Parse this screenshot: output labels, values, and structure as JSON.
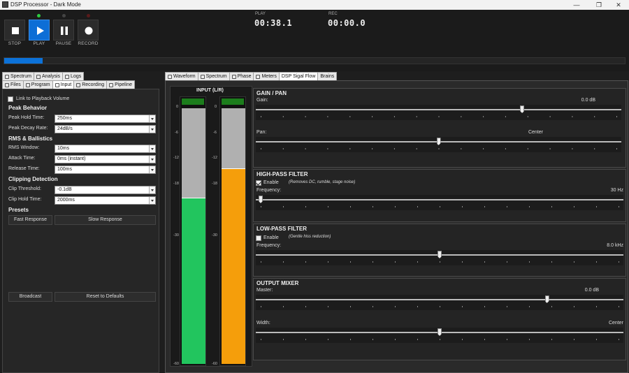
{
  "window": {
    "title": "DSP Processor - Dark Mode",
    "minimize_glyph": "—",
    "maximize_glyph": "❐",
    "close_glyph": "✕"
  },
  "transport": {
    "buttons": [
      {
        "label": "STOP",
        "icon": "stop-icon"
      },
      {
        "label": "PLAY",
        "icon": "play-icon",
        "active": true
      },
      {
        "label": "PAUSE",
        "icon": "pause-icon"
      },
      {
        "label": "RECORD",
        "icon": "record-icon"
      }
    ],
    "play_label": "PLAY",
    "play_time": "00:38.1",
    "rec_label": "REC",
    "rec_time": "00:00.0",
    "progress_fraction": 0.062,
    "led_colors": {
      "play": "#2ecc40",
      "pause": "#444444",
      "record": "#5a1a1a"
    },
    "accent": "#0d6ed6"
  },
  "left_tabs": {
    "row1": [
      "Spectrum",
      "Analysis",
      "Logs"
    ],
    "row2": [
      "Files",
      "Program",
      "Input",
      "Recording",
      "Pipeline"
    ],
    "selected": "Input"
  },
  "input_panel": {
    "link_label": "Link to Playback Volume",
    "link_checked": false,
    "peak_title": "Peak Behavior",
    "peak_hold_label": "Peak Hold Time:",
    "peak_hold_value": "250ms",
    "peak_decay_label": "Peak Decay Rate:",
    "peak_decay_value": "24dB/s",
    "rms_title": "RMS & Ballistics",
    "rms_window_label": "RMS Window:",
    "rms_window_value": "10ms",
    "attack_label": "Attack Time:",
    "attack_value": "0ms (instant)",
    "release_label": "Release Time:",
    "release_value": "100ms",
    "clip_title": "Clipping Detection",
    "clip_threshold_label": "Clip Threshold:",
    "clip_threshold_value": "-0.1dB",
    "clip_hold_label": "Clip Hold Time:",
    "clip_hold_value": "2000ms",
    "presets_title": "Presets",
    "fast_label": "Fast Response",
    "slow_label": "Slow Response",
    "broadcast_label": "Broadcast",
    "reset_label": "Reset to Defaults"
  },
  "right_tabs": {
    "items": [
      "Waveform",
      "Spectrum",
      "Phase",
      "Meters",
      "DSP Sigal Flow",
      "Brains"
    ],
    "selected": "DSP Sigal Flow"
  },
  "meters": {
    "title": "INPUT (L/R)",
    "ticks": [
      "0",
      "-6",
      "-12",
      "-18",
      "-30",
      "-60"
    ],
    "left": {
      "fill_fraction": 0.65,
      "color": "#22c55e"
    },
    "right": {
      "fill_fraction": 0.765,
      "color": "#f59e0b"
    }
  },
  "gain_pan": {
    "title": "GAIN / PAN",
    "gain_label": "Gain:",
    "gain_value": "0.0 dB",
    "gain_position": 0.735,
    "pan_label": "Pan:",
    "pan_value": "Center",
    "pan_position": 0.5
  },
  "hpf": {
    "title": "HIGH-PASS FILTER",
    "enable_label": "Enable",
    "enabled": true,
    "note": "(Removes DC, rumble, stage noise)",
    "freq_label": "Frequency:",
    "freq_value": "30 Hz",
    "freq_position": 0.0
  },
  "lpf": {
    "title": "LOW-PASS FILTER",
    "enable_label": "Enable",
    "enabled": false,
    "note": "(Gentle hiss reduction)",
    "freq_label": "Frequency:",
    "freq_value": "8.0 kHz",
    "freq_position": 0.5
  },
  "mixer": {
    "title": "OUTPUT MIXER",
    "master_label": "Master:",
    "master_value": "0.0 dB",
    "master_position": 0.8,
    "width_label": "Width:",
    "width_value": "Center",
    "width_position": 0.5
  }
}
